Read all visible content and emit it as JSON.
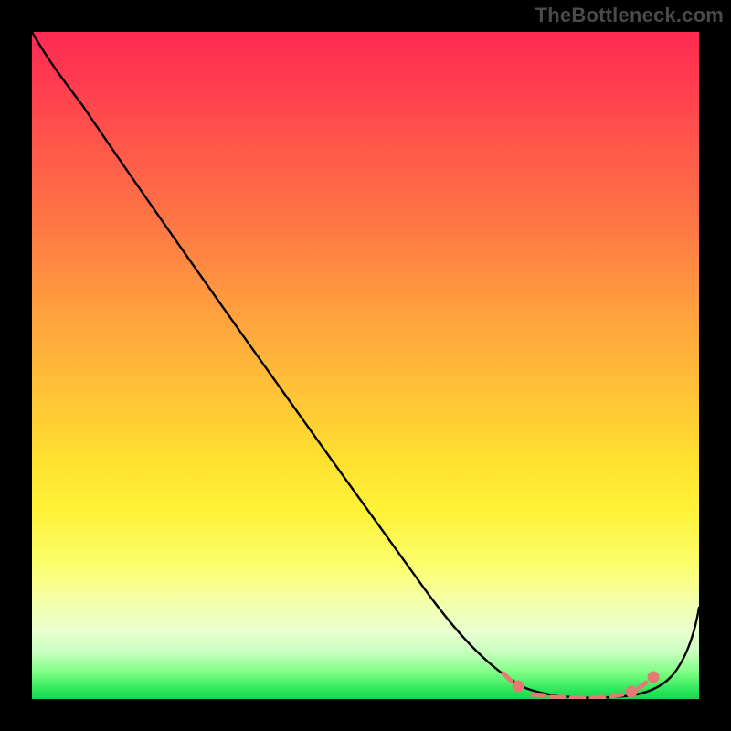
{
  "watermark": "TheBottleneck.com",
  "chart_data": {
    "type": "line",
    "title": "",
    "xlabel": "",
    "ylabel": "",
    "xlim": [
      0,
      100
    ],
    "ylim": [
      0,
      100
    ],
    "grid": false,
    "legend": false,
    "series": [
      {
        "name": "bottleneck-curve",
        "x": [
          0,
          7,
          15,
          25,
          35,
          45,
          55,
          60,
          64,
          68,
          72,
          76,
          80,
          84,
          88,
          90,
          93,
          96,
          100
        ],
        "y": [
          100,
          93,
          83,
          70,
          57,
          44,
          31,
          24,
          18,
          12,
          7,
          3,
          1,
          0,
          0,
          0,
          2,
          6,
          14
        ],
        "color": "#000000"
      }
    ],
    "optimal_markers": {
      "color": "#e47a72",
      "points_x": [
        72,
        75,
        78,
        80,
        82,
        84,
        86,
        88,
        90,
        92
      ],
      "points_y": [
        2.5,
        1.5,
        1,
        0.7,
        0.5,
        0.5,
        0.5,
        0.7,
        1.2,
        2.5
      ]
    },
    "gradient_stops": [
      {
        "pos": 0,
        "color": "#ff2a52"
      },
      {
        "pos": 30,
        "color": "#ff7a44"
      },
      {
        "pos": 64,
        "color": "#ffe02f"
      },
      {
        "pos": 86,
        "color": "#f3ffb0"
      },
      {
        "pos": 96,
        "color": "#7dff83"
      },
      {
        "pos": 100,
        "color": "#1ed356"
      }
    ]
  }
}
